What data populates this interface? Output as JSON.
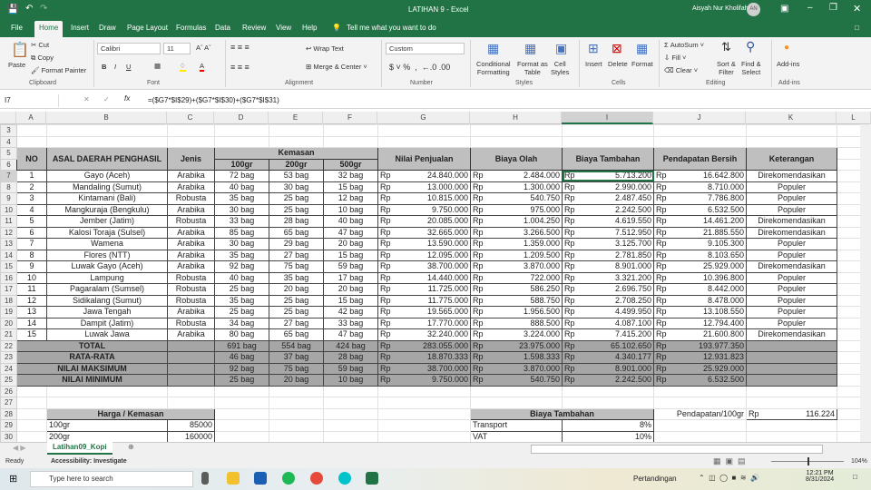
{
  "app": {
    "title": "LATIHAN 9  -  Excel",
    "user": "Aisyah Nur Kholifah",
    "initials": "AN"
  },
  "tabs": [
    "File",
    "Home",
    "Insert",
    "Draw",
    "Page Layout",
    "Formulas",
    "Data",
    "Review",
    "View",
    "Help"
  ],
  "tell_me": "Tell me what you want to do",
  "ribbon": {
    "paste": "Paste",
    "cut": "Cut",
    "copy": "Copy",
    "format_painter": "Format Painter",
    "clipboard": "Clipboard",
    "font_name": "Calibri",
    "font_size": "11",
    "font": "Font",
    "wrap": "Wrap Text",
    "merge": "Merge & Center",
    "alignment": "Alignment",
    "number_format": "Custom",
    "number": "Number",
    "cond1": "Conditional",
    "cond2": "Formatting",
    "fat1": "Format as",
    "fat2": "Table",
    "cs1": "Cell",
    "cs2": "Styles",
    "styles": "Styles",
    "insert": "Insert",
    "delete": "Delete",
    "format": "Format",
    "cells": "Cells",
    "autosum": "AutoSum",
    "fill": "Fill",
    "clear": "Clear",
    "sort1": "Sort &",
    "sort2": "Filter",
    "find1": "Find &",
    "find2": "Select",
    "editing": "Editing",
    "addins": "Add-ins",
    "addins_group": "Add-ins"
  },
  "formula_bar": {
    "name_box": "I7",
    "formula": "=($G7*$I$29)+($G7*$I$30)+($G7*$I$31)"
  },
  "columns": [
    "A",
    "B",
    "C",
    "D",
    "E",
    "F",
    "G",
    "H",
    "I",
    "J",
    "K",
    "L"
  ],
  "main": {
    "headers": {
      "no": "NO",
      "origin": "ASAL DAERAH PENGHASIL",
      "type": "Jenis",
      "kemasan": "Kemasan",
      "q100": "100gr",
      "q200": "200gr",
      "q500": "500gr",
      "sales": "Nilai Penjualan",
      "olah": "Biaya Olah",
      "tambahan": "Biaya Tambahan",
      "bersih": "Pendapatan Bersih",
      "ket": "Keterangan"
    },
    "currency": "Rp",
    "rows": [
      [
        "1",
        "Gayo (Aceh)",
        "Arabika",
        "72 bag",
        "53 bag",
        "32 bag",
        "24.840.000",
        "2.484.000",
        "5.713.200",
        "16.642.800",
        "Direkomendasikan"
      ],
      [
        "2",
        "Mandaling (Sumut)",
        "Arabika",
        "40 bag",
        "30 bag",
        "15 bag",
        "13.000.000",
        "1.300.000",
        "2.990.000",
        "8.710.000",
        "Populer"
      ],
      [
        "3",
        "Kintamani (Bali)",
        "Robusta",
        "35 bag",
        "25 bag",
        "12 bag",
        "10.815.000",
        "540.750",
        "2.487.450",
        "7.786.800",
        "Populer"
      ],
      [
        "4",
        "Mangkuraja (Bengkulu)",
        "Arabika",
        "30 bag",
        "25 bag",
        "10 bag",
        "9.750.000",
        "975.000",
        "2.242.500",
        "6.532.500",
        "Populer"
      ],
      [
        "5",
        "Jember (Jatim)",
        "Robusta",
        "33 bag",
        "28 bag",
        "40 bag",
        "20.085.000",
        "1.004.250",
        "4.619.550",
        "14.461.200",
        "Direkomendasikan"
      ],
      [
        "6",
        "Kalosi Toraja (Sulsel)",
        "Arabika",
        "85 bag",
        "65 bag",
        "47 bag",
        "32.665.000",
        "3.266.500",
        "7.512.950",
        "21.885.550",
        "Direkomendasikan"
      ],
      [
        "7",
        "Wamena",
        "Arabika",
        "30 bag",
        "29 bag",
        "20 bag",
        "13.590.000",
        "1.359.000",
        "3.125.700",
        "9.105.300",
        "Populer"
      ],
      [
        "8",
        "Flores (NTT)",
        "Arabika",
        "35 bag",
        "27 bag",
        "15 bag",
        "12.095.000",
        "1.209.500",
        "2.781.850",
        "8.103.650",
        "Populer"
      ],
      [
        "9",
        "Luwak Gayo (Aceh)",
        "Arabika",
        "92 bag",
        "75 bag",
        "59 bag",
        "38.700.000",
        "3.870.000",
        "8.901.000",
        "25.929.000",
        "Direkomendasikan"
      ],
      [
        "10",
        "Lampung",
        "Robusta",
        "40 bag",
        "35 bag",
        "17 bag",
        "14.440.000",
        "722.000",
        "3.321.200",
        "10.396.800",
        "Populer"
      ],
      [
        "11",
        "Pagaralam (Sumsel)",
        "Robusta",
        "25 bag",
        "20 bag",
        "20 bag",
        "11.725.000",
        "586.250",
        "2.696.750",
        "8.442.000",
        "Populer"
      ],
      [
        "12",
        "Sidikalang (Sumut)",
        "Robusta",
        "35 bag",
        "25 bag",
        "15 bag",
        "11.775.000",
        "588.750",
        "2.708.250",
        "8.478.000",
        "Populer"
      ],
      [
        "13",
        "Jawa Tengah",
        "Arabika",
        "25 bag",
        "25 bag",
        "42 bag",
        "19.565.000",
        "1.956.500",
        "4.499.950",
        "13.108.550",
        "Populer"
      ],
      [
        "14",
        "Dampit (Jatim)",
        "Robusta",
        "34 bag",
        "27 bag",
        "33 bag",
        "17.770.000",
        "888.500",
        "4.087.100",
        "12.794.400",
        "Populer"
      ],
      [
        "15",
        "Luwak Jawa",
        "Arabika",
        "80 bag",
        "65 bag",
        "47 bag",
        "32.240.000",
        "3.224.000",
        "7.415.200",
        "21.600.800",
        "Direkomendasikan"
      ]
    ],
    "summary": [
      [
        "TOTAL",
        "691 bag",
        "554 bag",
        "424 bag",
        "283.055.000",
        "23.975.000",
        "65.102.650",
        "193.977.350"
      ],
      [
        "RATA-RATA",
        "46 bag",
        "37 bag",
        "28 bag",
        "18.870.333",
        "1.598.333",
        "4.340.177",
        "12.931.823"
      ],
      [
        "NILAI MAKSIMUM",
        "92 bag",
        "75 bag",
        "59 bag",
        "38.700.000",
        "3.870.000",
        "8.901.000",
        "25.929.000"
      ],
      [
        "NILAI MINIMUM",
        "25 bag",
        "20 bag",
        "10 bag",
        "9.750.000",
        "540.750",
        "2.242.500",
        "6.532.500"
      ]
    ]
  },
  "harga": {
    "title": "Harga / Kemasan",
    "rows": [
      [
        "100gr",
        "85000"
      ],
      [
        "200gr",
        "160000"
      ]
    ]
  },
  "biaya": {
    "title": "Biaya Tambahan",
    "rows": [
      [
        "Transport",
        "8%"
      ],
      [
        "VAT",
        "10%"
      ]
    ]
  },
  "pendapatan": {
    "label": "Pendapatan/100gr",
    "currency": "Rp",
    "value": "116.224"
  },
  "sheet_tab": "Latihan09_Kopi",
  "status": {
    "ready": "Ready",
    "accessibility": "Accessibility: Investigate",
    "zoom": "104%"
  },
  "taskbar": {
    "search": "Type here to search",
    "news": "Pertandingan",
    "time": "12:21 PM",
    "date": "8/31/2024"
  }
}
